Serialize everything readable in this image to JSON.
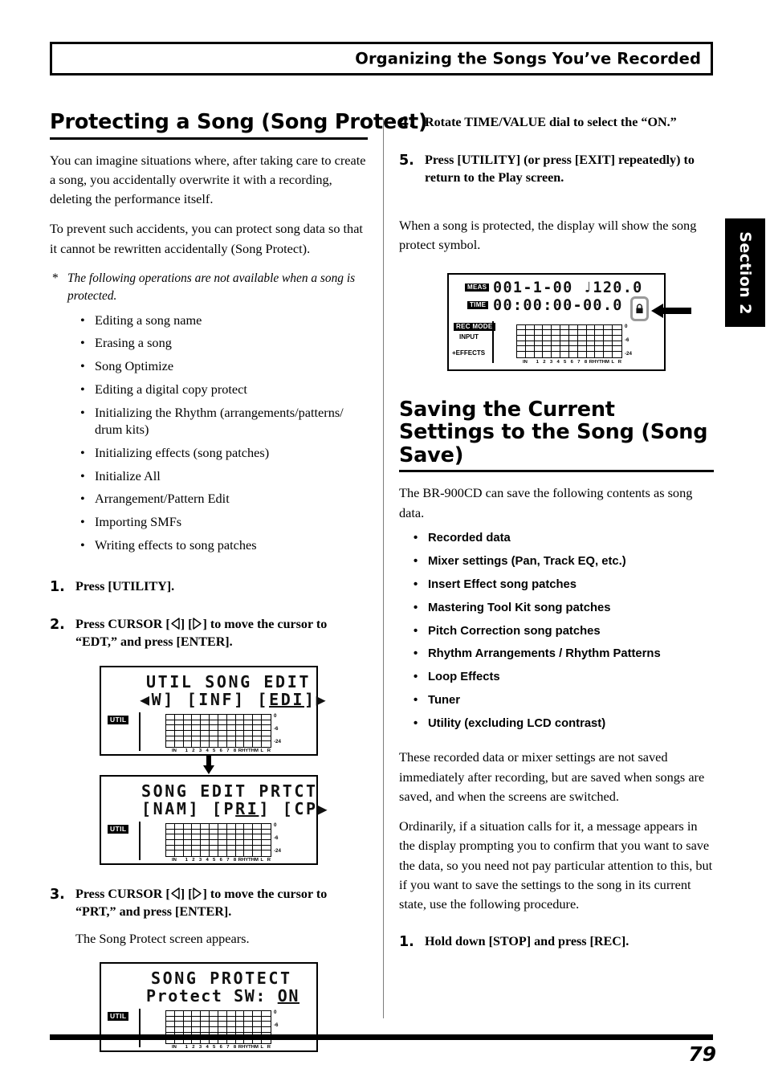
{
  "header": {
    "title": "Organizing the Songs You’ve Recorded"
  },
  "section_tab": {
    "label": "Section 2"
  },
  "footer": {
    "page_number": "79"
  },
  "left_column": {
    "heading": "Protecting a Song (Song Protect)",
    "paragraph1": "You can imagine situations where, after taking care to create a song, you accidentally overwrite it with a recording, deleting the performance itself.",
    "paragraph2": "To prevent such accidents, you can protect song data so that it cannot be rewritten accidentally (Song Protect).",
    "note_marker": "*",
    "note": "The following operations are not available when a song is protected.",
    "restricted_operations": [
      "Editing a song name",
      "Erasing a song",
      "Song Optimize",
      "Editing a digital copy protect",
      "Initializing the Rhythm (arrangements/patterns/ drum kits)",
      "Initializing effects (song patches)",
      "Initialize All",
      "Arrangement/Pattern Edit",
      "Importing SMFs",
      "Writing effects to song patches"
    ],
    "steps": [
      {
        "number": "1.",
        "text_before": "Press [UTILITY].",
        "text_after": "",
        "has_cursor_icons": false,
        "sub": ""
      },
      {
        "number": "2.",
        "text_before": "Press CURSOR [",
        "text_mid": "] [",
        "text_after": "] to move the cursor to “EDT,” and press [ENTER].",
        "has_cursor_icons": true,
        "sub": ""
      },
      {
        "number": "3.",
        "text_before": "Press CURSOR [",
        "text_mid": "] [",
        "text_after": "] to move the cursor to “PRT,” and press [ENTER].",
        "has_cursor_icons": true,
        "sub": "The Song Protect screen appears."
      }
    ]
  },
  "right_column": {
    "steps_continued": [
      {
        "number": "4.",
        "text": "Rotate TIME/VALUE dial to select the “ON.”"
      },
      {
        "number": "5.",
        "text": "Press [UTILITY] (or press [EXIT] repeatedly) to return to the Play screen."
      }
    ],
    "paragraph_protect": "When a song is protected, the display will show the song protect symbol.",
    "heading": "Saving the Current Settings to the Song (Song Save)",
    "intro": "The BR-900CD can save the following contents as song data.",
    "saved_items": [
      "Recorded data",
      "Mixer settings (Pan, Track EQ, etc.)",
      "Insert Effect song patches",
      "Mastering Tool Kit song patches",
      "Pitch Correction song patches",
      "Rhythm Arrangements / Rhythm Patterns",
      "Loop Effects",
      "Tuner",
      "Utility (excluding LCD contrast)"
    ],
    "paragraph_saved": "These recorded data or mixer settings are not saved immediately after recording, but are saved when songs are saved, and when the screens are switched.",
    "paragraph_ordinarily": "Ordinarily, if a situation calls for it, a message appears in the display prompting you to confirm that you want to save the data, so you need not pay particular attention to this, but if you want to save the settings to the song in its current state, use the following procedure.",
    "final_step": {
      "number": "1.",
      "text": "Hold down [STOP] and press [REC]."
    }
  },
  "lcd_screens": {
    "screen1": {
      "line1": "UTIL  SONG EDIT",
      "line2_prefix": "◀W] [INF] [",
      "line2_cursor": "EDI",
      "line2_suffix": "]▶",
      "badge": "UTIL"
    },
    "screen2": {
      "line1": "SONG EDIT  PRTCT",
      "line2_prefix": "[NAM] [P",
      "line2_cursor": "RI",
      "line2_suffix": "] [CP▶",
      "badge": "UTIL"
    },
    "screen3": {
      "line1": "SONG PROTECT",
      "line2_prefix": "Protect SW: ",
      "line2_cursor": "ON",
      "line2_suffix": "",
      "badge": "UTIL"
    },
    "screen_play": {
      "label_meas": "MEAS",
      "label_time": "TIME",
      "line_meas": "001-1-00  ♩120.0",
      "line_time": "00:00:00-00.0",
      "label_recmode": "REC MODE",
      "label_input": "INPUT",
      "label_effects": "+EFFECTS"
    },
    "meter_scale": [
      "0",
      "-6",
      "-24"
    ],
    "track_labels": [
      "IN",
      "1",
      "2",
      "3",
      "4",
      "5",
      "6",
      "7",
      "8",
      "RHYTHM",
      "L",
      "R"
    ]
  }
}
